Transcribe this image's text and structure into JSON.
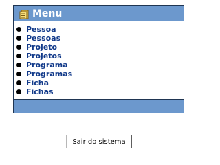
{
  "menu": {
    "title": "Menu",
    "icon": "menu-notes-icon",
    "items": [
      {
        "label": "Pessoa"
      },
      {
        "label": "Pessoas"
      },
      {
        "label": "Projeto"
      },
      {
        "label": "Projetos"
      },
      {
        "label": "Programa"
      },
      {
        "label": "Programas"
      },
      {
        "label": "Ficha"
      },
      {
        "label": "Fichas"
      }
    ]
  },
  "actions": {
    "logout_label": "Sair do sistema"
  },
  "colors": {
    "header_bg": "#6c98cd",
    "border": "#1f3552",
    "link": "#123a8a",
    "icon_fill": "#f2cf52"
  }
}
